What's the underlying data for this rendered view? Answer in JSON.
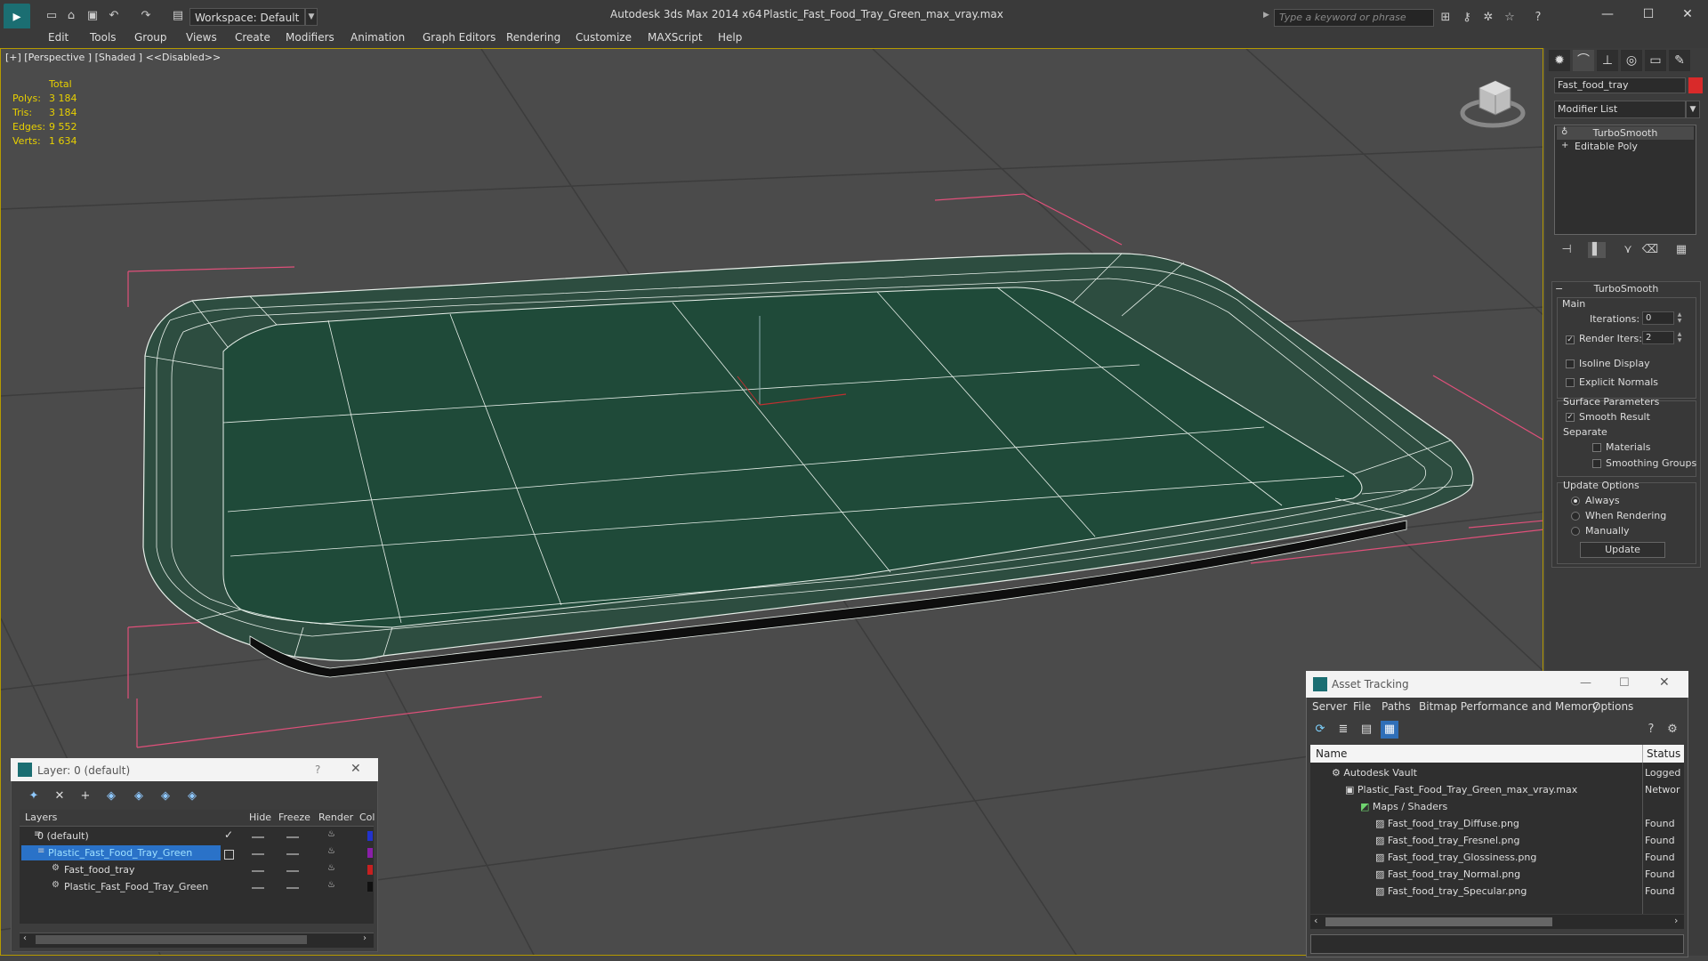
{
  "window": {
    "app_title": "Autodesk 3ds Max  2014 x64",
    "file_title": "Plastic_Fast_Food_Tray_Green_max_vray.max",
    "workspace": "Workspace: Default",
    "search_placeholder": "Type a keyword or phrase"
  },
  "menu": [
    "Edit",
    "Tools",
    "Group",
    "Views",
    "Create",
    "Modifiers",
    "Animation",
    "Graph Editors",
    "Rendering",
    "Customize",
    "MAXScript",
    "Help"
  ],
  "viewport": {
    "label": "[+] [Perspective ] [Shaded ]  <<Disabled>>",
    "stats_header": "Total",
    "stats": [
      {
        "label": "Polys:",
        "value": "3 184"
      },
      {
        "label": "Tris:",
        "value": "3 184"
      },
      {
        "label": "Edges:",
        "value": "9 552"
      },
      {
        "label": "Verts:",
        "value": "1 634"
      }
    ],
    "colors": {
      "tray": "#1f4a39",
      "wire": "#e8f0ea",
      "bbox": "#e0507a",
      "grid": "#3a3a3a",
      "bg": "#4b4b4b"
    }
  },
  "command_panel": {
    "object_name": "Fast_food_tray",
    "object_color": "#d92a2a",
    "modifier_list": "Modifier List",
    "stack": [
      "TurboSmooth",
      "Editable Poly"
    ],
    "rollout_title": "TurboSmooth",
    "main_label": "Main",
    "iterations_label": "Iterations:",
    "iterations_value": "0",
    "render_iters_label": "Render Iters:",
    "render_iters_value": "2",
    "isoline_display": "Isoline Display",
    "explicit_normals": "Explicit Normals",
    "surface_parameters": "Surface Parameters",
    "smooth_result": "Smooth Result",
    "separate": "Separate",
    "materials": "Materials",
    "smoothing_groups": "Smoothing Groups",
    "update_options": "Update Options",
    "always": "Always",
    "when_rendering": "When Rendering",
    "manually": "Manually",
    "update_button": "Update"
  },
  "layer_window": {
    "title": "Layer: 0 (default)",
    "help": "?",
    "col_layers": "Layers",
    "col_hide": "Hide",
    "col_freeze": "Freeze",
    "col_render": "Render",
    "col_color": "Col",
    "rows": [
      {
        "name": "0 (default)",
        "color": "#2233cc"
      },
      {
        "name": "Plastic_Fast_Food_Tray_Green",
        "color": "#8a1fa8"
      },
      {
        "name": "Fast_food_tray",
        "color": "#c62020"
      },
      {
        "name": "Plastic_Fast_Food_Tray_Green",
        "color": "#111111"
      }
    ]
  },
  "asset_window": {
    "title": "Asset Tracking",
    "menu": [
      "Server",
      "File",
      "Paths",
      "Bitmap Performance and Memory",
      "Options"
    ],
    "col_name": "Name",
    "col_status": "Status",
    "rows": [
      {
        "name": "Autodesk Vault",
        "status": "Logged"
      },
      {
        "name": "Plastic_Fast_Food_Tray_Green_max_vray.max",
        "status": "Networ"
      },
      {
        "name": "Maps / Shaders",
        "status": ""
      },
      {
        "name": "Fast_food_tray_Diffuse.png",
        "status": "Found"
      },
      {
        "name": "Fast_food_tray_Fresnel.png",
        "status": "Found"
      },
      {
        "name": "Fast_food_tray_Glossiness.png",
        "status": "Found"
      },
      {
        "name": "Fast_food_tray_Normal.png",
        "status": "Found"
      },
      {
        "name": "Fast_food_tray_Specular.png",
        "status": "Found"
      }
    ]
  }
}
